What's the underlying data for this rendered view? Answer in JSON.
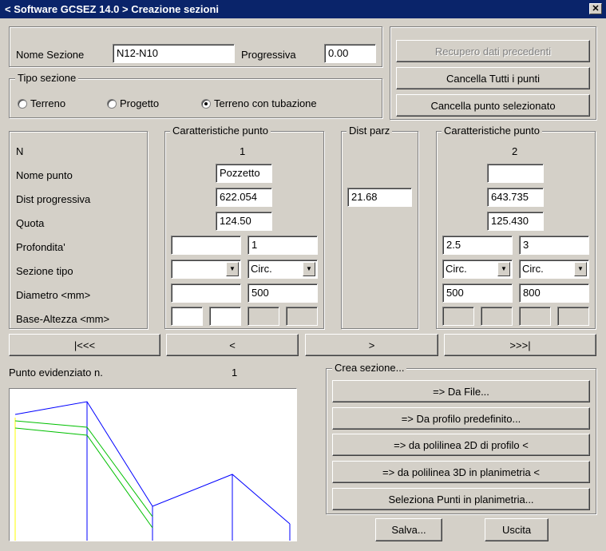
{
  "title": "< Software GCSEZ 14.0 >  Creazione sezioni",
  "close_symbol": "✕",
  "header": {
    "nome_sezione_label": "Nome Sezione",
    "nome_sezione_value": "N12-N10",
    "progressiva_label": "Progressiva",
    "progressiva_value": "0.00"
  },
  "tipo_sezione": {
    "legend": "Tipo sezione",
    "options": [
      "Terreno",
      "Progetto",
      "Terreno con tubazione"
    ],
    "selected": "Terreno con tubazione"
  },
  "actions": {
    "recupero": "Recupero dati precedenti",
    "cancella_tutti": "Cancella Tutti i punti",
    "cancella_sel": "Cancella punto selezionato"
  },
  "row_labels": [
    "N",
    "Nome punto",
    "Dist progressiva",
    "Quota",
    "Profondita'",
    "Sezione tipo",
    "Diametro <mm>",
    "Base-Altezza <mm>"
  ],
  "point1": {
    "legend": "Caratteristiche punto",
    "n": "1",
    "nome": "Pozzetto",
    "dist": "622.054",
    "quota": "124.50",
    "prof_a": "",
    "prof_b": "1",
    "sez_a": "",
    "sez_b": "Circ.",
    "diam_a": "",
    "diam_b": "500"
  },
  "dist_parz": {
    "legend": "Dist parz",
    "value": "21.68"
  },
  "point2": {
    "legend": "Caratteristiche punto",
    "n": "2",
    "nome": "",
    "dist": "643.735",
    "quota": "125.430",
    "prof_a": "2.5",
    "prof_b": "3",
    "sez_a": "Circ.",
    "sez_b": "Circ.",
    "diam_a": "500",
    "diam_b": "800"
  },
  "nav": {
    "first": "|<<<",
    "prev": "<",
    "next": ">",
    "last": ">>>|"
  },
  "punto_evidenziato_label": "Punto evidenziato n.",
  "punto_evidenziato_value": "1",
  "crea_sezione": {
    "legend": "Crea sezione...",
    "da_file": "=> Da File...",
    "da_profilo": "=> Da profilo predefinito...",
    "da_polilinea_2d": "=> da polilinea 2D di profilo <",
    "da_polilinea_3d": "=> da polilinea 3D in planimetria <",
    "seleziona": "Seleziona Punti in planimetria..."
  },
  "footer": {
    "salva": "Salva...",
    "uscita": "Uscita"
  },
  "plot_colors": {
    "terrain": "#0000ff",
    "pipe": "#00c000",
    "axis": "#ffff00"
  }
}
